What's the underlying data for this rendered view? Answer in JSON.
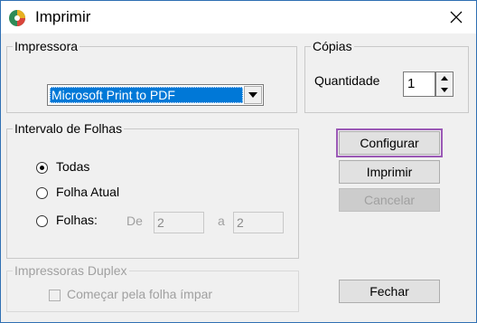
{
  "window": {
    "title": "Imprimir"
  },
  "printer_group": {
    "label": "Impressora",
    "selected_printer": "Microsoft Print to PDF"
  },
  "copies_group": {
    "label": "Cópias",
    "quantity_label": "Quantidade",
    "quantity_value": "1"
  },
  "range_group": {
    "label": "Intervalo de Folhas",
    "options": [
      {
        "label": "Todas",
        "checked": true
      },
      {
        "label": "Folha Atual",
        "checked": false
      },
      {
        "label": "Folhas:",
        "checked": false
      }
    ],
    "from_label": "De",
    "from_value": "2",
    "to_label": "a",
    "to_value": "2"
  },
  "duplex_group": {
    "label": "Impressoras Duplex",
    "checkbox_label": "Começar pela folha ímpar"
  },
  "buttons": {
    "configure": "Configurar",
    "print": "Imprimir",
    "cancel": "Cancelar",
    "close": "Fechar"
  },
  "colors": {
    "selection": "#0078d7",
    "focus_outline": "#9b59b6",
    "window_border": "#2f6fb3"
  }
}
